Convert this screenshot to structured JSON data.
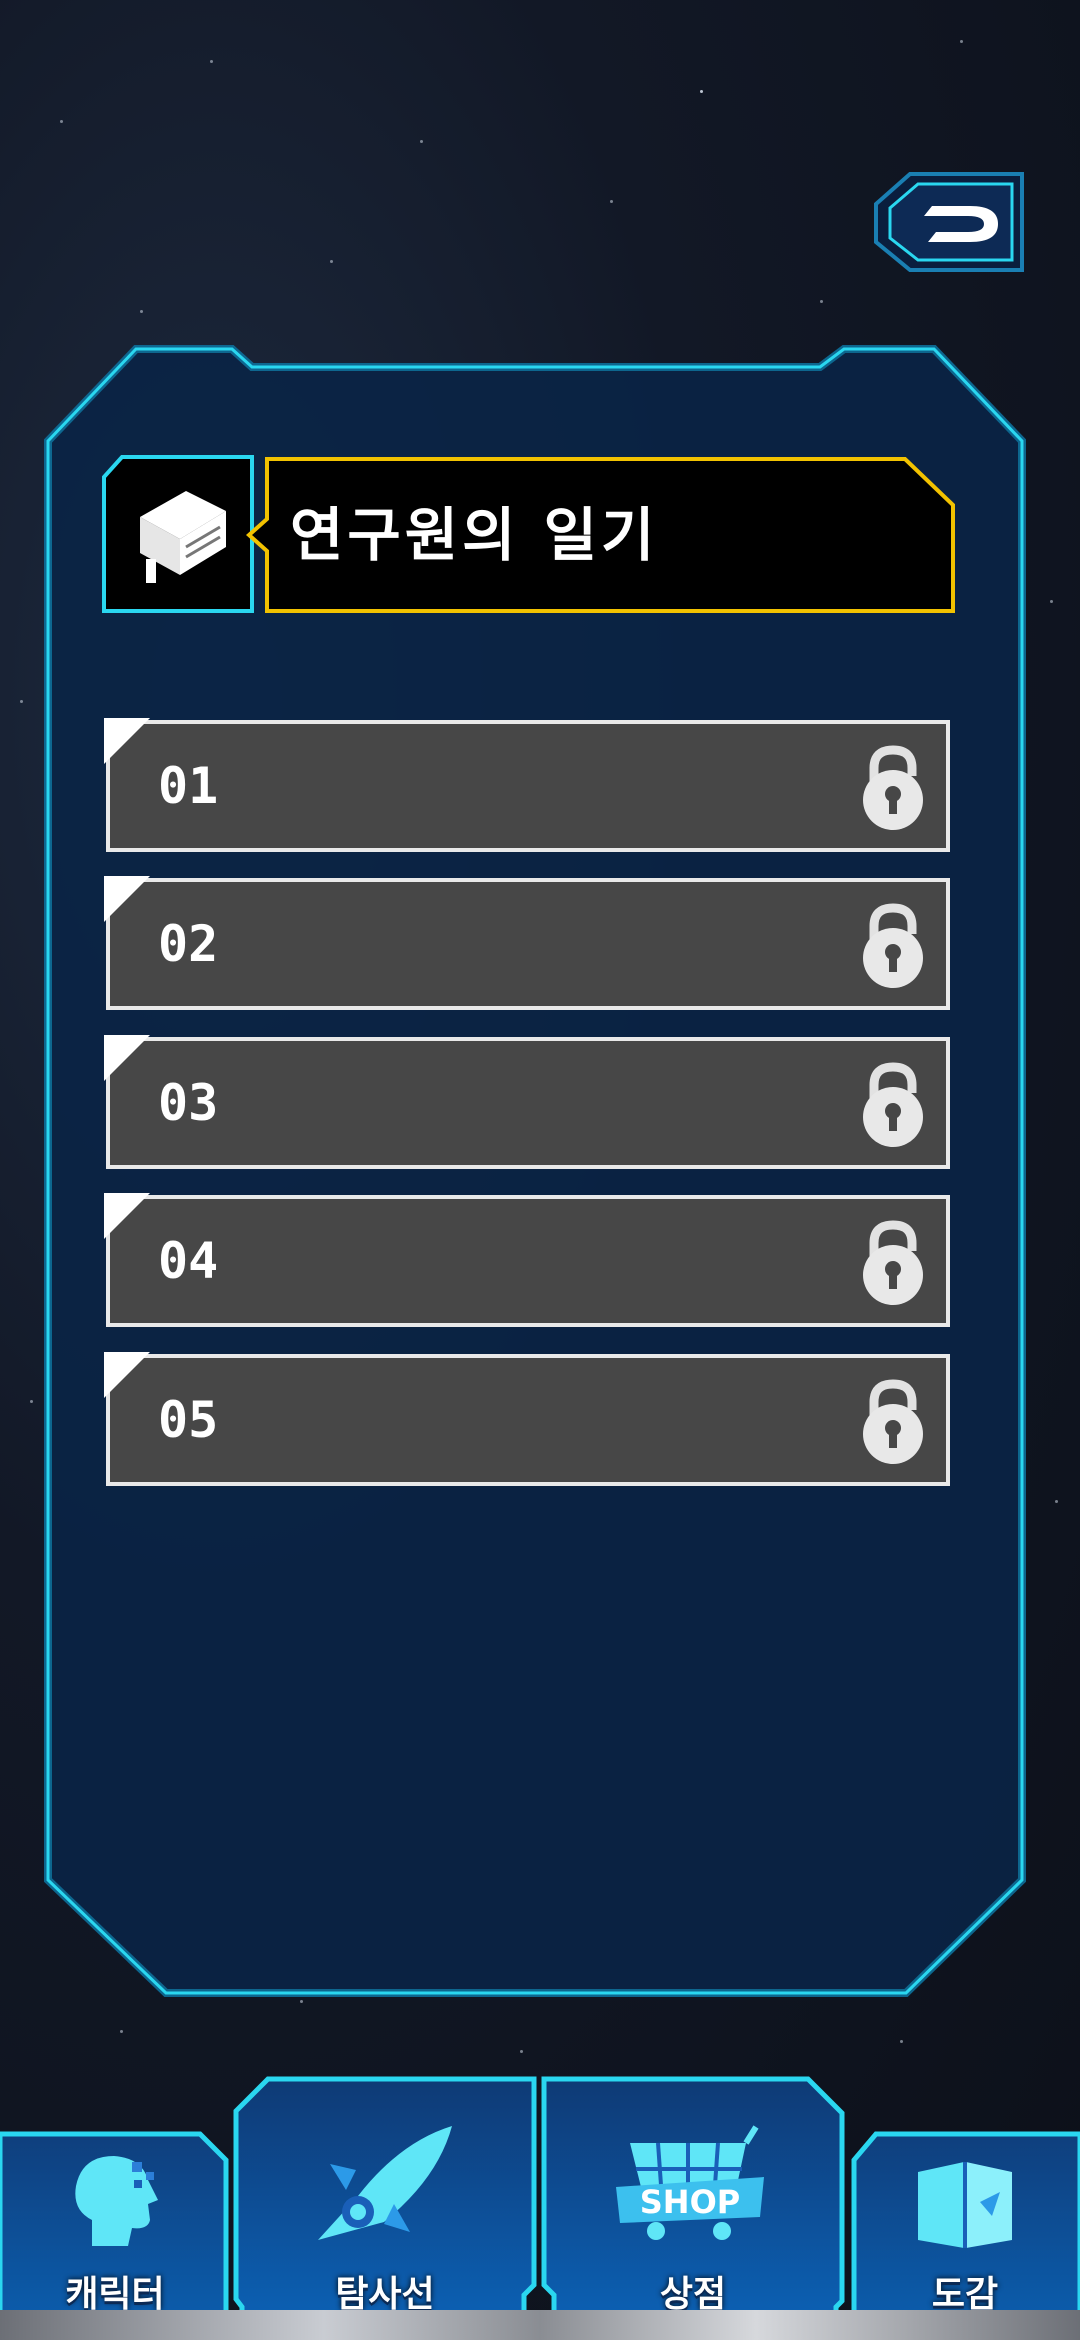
{
  "title": "연구원의 일기",
  "entries": [
    {
      "label": "01",
      "locked": true
    },
    {
      "label": "02",
      "locked": true
    },
    {
      "label": "03",
      "locked": true
    },
    {
      "label": "04",
      "locked": true
    },
    {
      "label": "05",
      "locked": true
    }
  ],
  "nav": {
    "character": "캐릭터",
    "explorer": "탐사선",
    "shop": "상점",
    "shop_badge": "SHOP",
    "encyclopedia": "도감"
  },
  "colors": {
    "panel_fill": "#0a2446",
    "panel_border": "#2ad7f0",
    "title_border": "#f2c200",
    "entry_fill": "#474747",
    "nav_fill": "#0e4d96"
  },
  "icons": [
    "back-icon",
    "diary-book-icon",
    "lock-icon",
    "character-head-icon",
    "spaceship-icon",
    "shop-cart-icon",
    "open-book-icon"
  ]
}
